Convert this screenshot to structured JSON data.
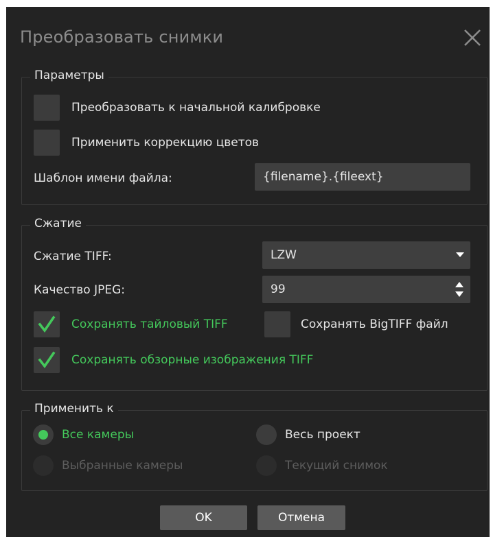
{
  "dialog": {
    "title": "Преобразовать снимки"
  },
  "params": {
    "group_label": "Параметры",
    "convert_calibration": {
      "label": "Преобразовать к начальной калибровке",
      "checked": false
    },
    "color_correction": {
      "label": "Применить коррекцию цветов",
      "checked": false
    },
    "filename_template_label": "Шаблон имени файла:",
    "filename_template_value": "{filename}.{fileext}"
  },
  "compression": {
    "group_label": "Сжатие",
    "tiff_label": "Сжатие TIFF:",
    "tiff_value": "LZW",
    "jpeg_label": "Качество JPEG:",
    "jpeg_value": "99",
    "tiled_tiff": {
      "label": "Сохранять тайловый TIFF",
      "checked": true
    },
    "bigtiff": {
      "label": "Сохранять BigTIFF файл",
      "checked": false
    },
    "overview_tiff": {
      "label": "Сохранять обзорные изображения TIFF",
      "checked": true
    }
  },
  "apply_to": {
    "group_label": "Применить к",
    "options": [
      {
        "label": "Все камеры",
        "selected": true,
        "enabled": true
      },
      {
        "label": "Весь проект",
        "selected": false,
        "enabled": true
      },
      {
        "label": "Выбранные камеры",
        "selected": false,
        "enabled": false
      },
      {
        "label": "Текущий снимок",
        "selected": false,
        "enabled": false
      }
    ]
  },
  "buttons": {
    "ok": "OK",
    "cancel": "Отмена"
  },
  "colors": {
    "background": "#232323",
    "accent_green": "#44c85b",
    "control": "#3c3c3c",
    "button": "#5a5a5a"
  },
  "icons": [
    "close-icon",
    "checkmark-icon",
    "dropdown-arrow-icon",
    "spinner-arrows-icon"
  ]
}
